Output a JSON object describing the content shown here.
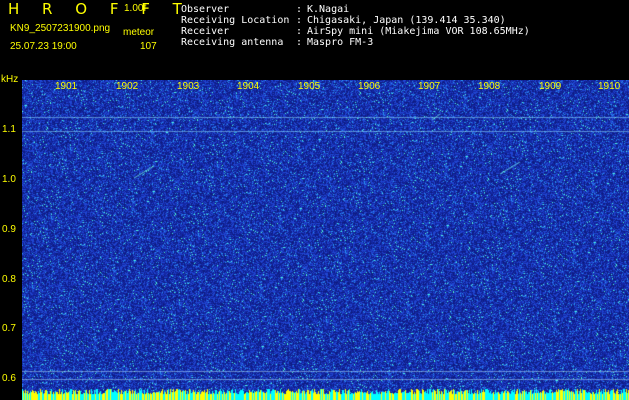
{
  "header": {
    "title": "H R O F F T",
    "version": "1.00f",
    "filename": "KN9_2507231900.png",
    "meteor_label": "meteor",
    "meteor_count": "107",
    "datetime": "25.07.23 19:00"
  },
  "info": [
    {
      "label": "Observer",
      "value": "K.Nagai"
    },
    {
      "label": "Receiving Location",
      "value": "Chigasaki, Japan (139.414 35.340)"
    },
    {
      "label": "Receiver",
      "value": "AirSpy mini (Miakejima VOR 108.65MHz)"
    },
    {
      "label": "Receiving antenna",
      "value": "Maspro FM-3"
    }
  ],
  "spectrogram": {
    "freq_unit": "kHz",
    "freq_labels": [
      "1.1",
      "1.0",
      "0.9",
      "0.8",
      "0.7",
      "0.6"
    ],
    "time_labels": [
      "1901",
      "1902",
      "1903",
      "1904",
      "1905",
      "1906",
      "1907",
      "1908",
      "1909",
      "1910"
    ],
    "colors": {
      "background": "#1a2fa0",
      "noise": "#2a50e0",
      "echo": "#00ffff",
      "bottom_band": "#ffff00"
    }
  }
}
